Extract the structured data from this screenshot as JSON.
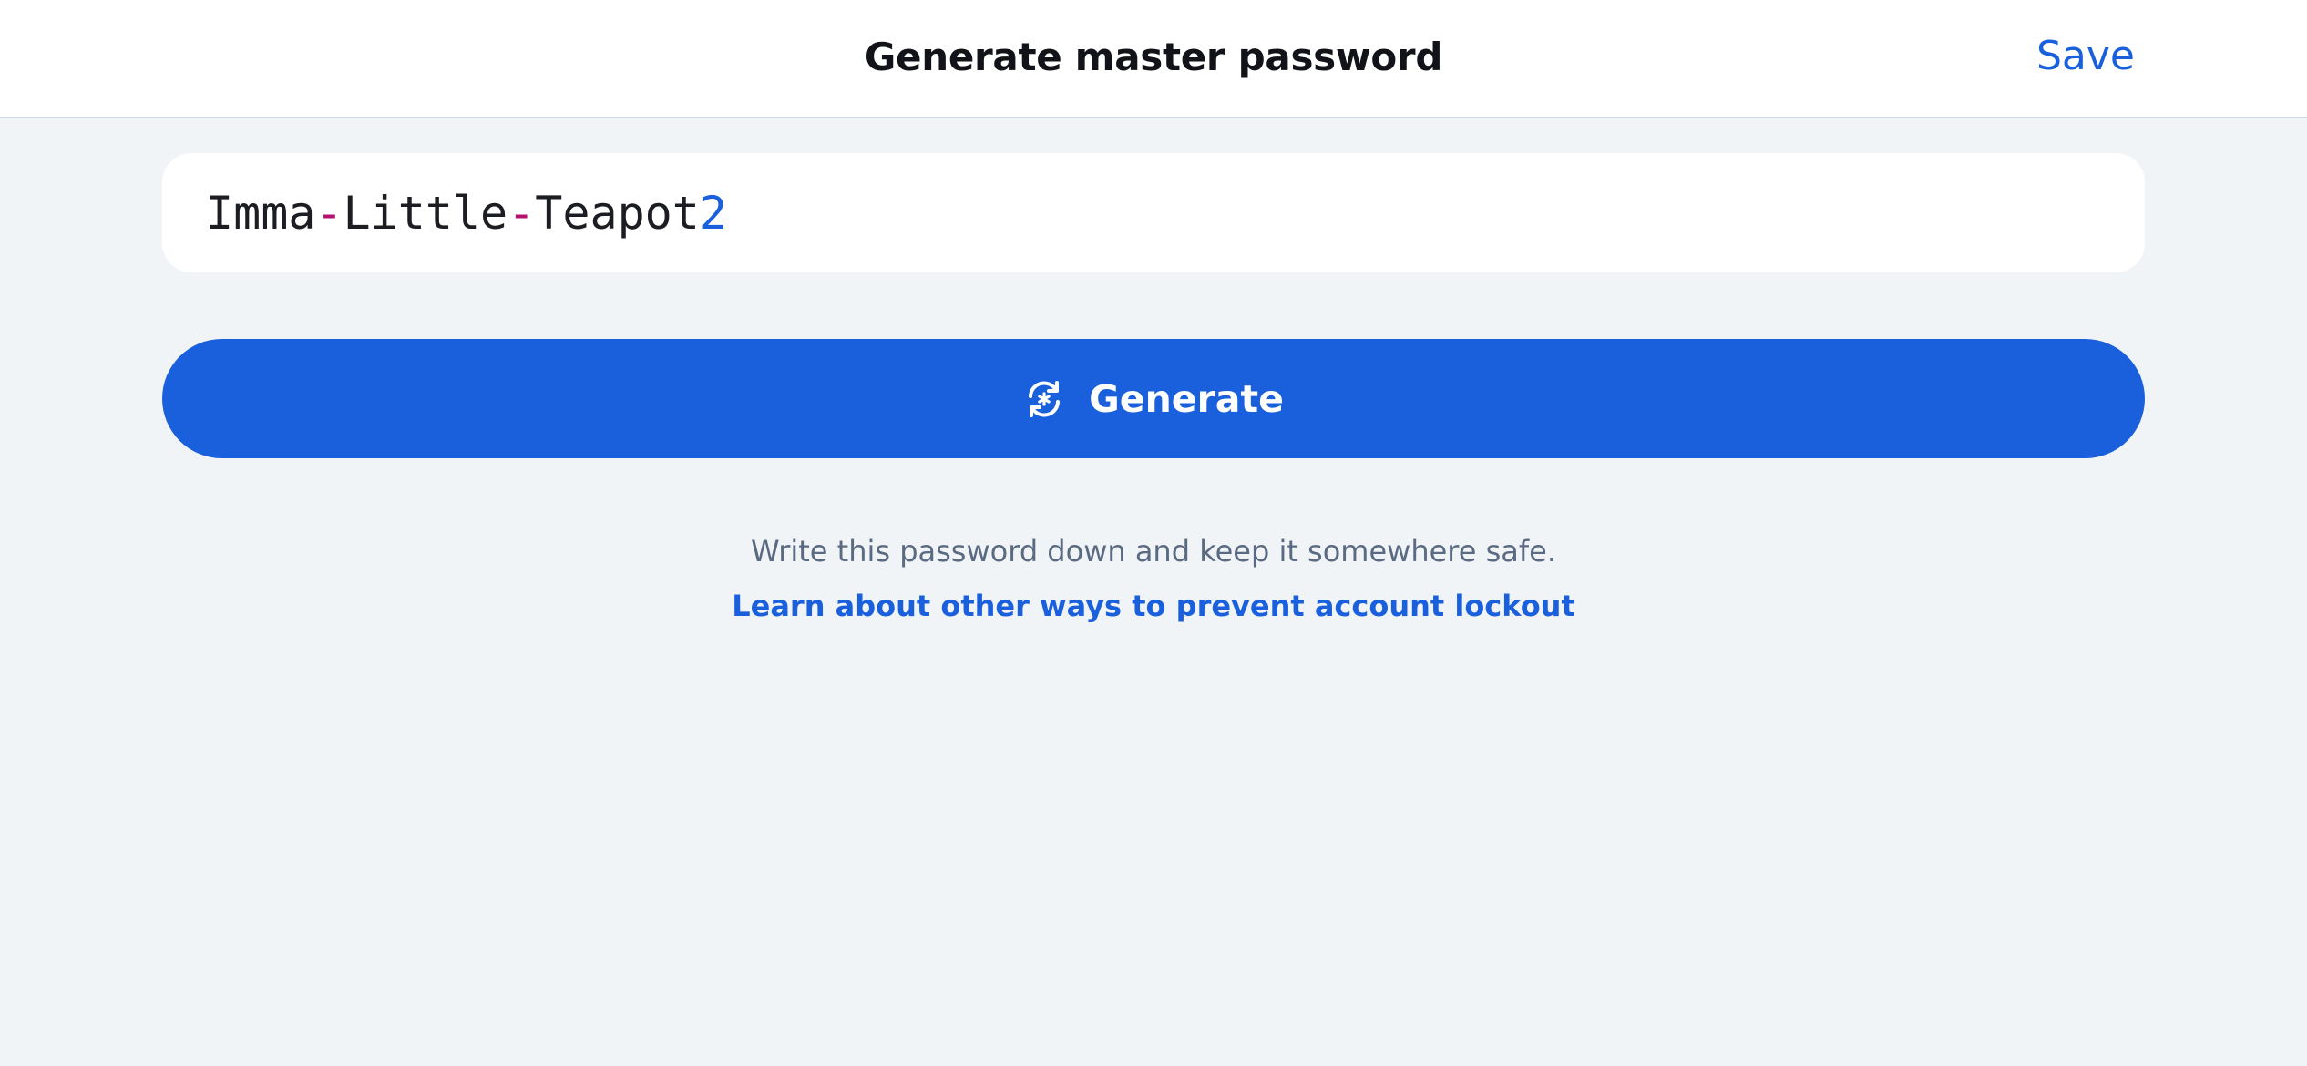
{
  "header": {
    "title": "Generate master password",
    "save_label": "Save"
  },
  "password": {
    "segments": [
      {
        "text": "Imma",
        "kind": "word"
      },
      {
        "text": "-",
        "kind": "separator"
      },
      {
        "text": "Little",
        "kind": "word"
      },
      {
        "text": "-",
        "kind": "separator"
      },
      {
        "text": "Teapot",
        "kind": "word"
      },
      {
        "text": "2",
        "kind": "digit"
      }
    ]
  },
  "generate_button": {
    "label": "Generate",
    "icon": "refresh-icon"
  },
  "hint": {
    "text": "Write this password down and keep it somewhere safe.",
    "link_label": "Learn about other ways to prevent account lockout"
  },
  "colors": {
    "accent": "#1a5fdc",
    "separator": "#b3126f",
    "background": "#f1f4f7",
    "surface": "#ffffff"
  }
}
